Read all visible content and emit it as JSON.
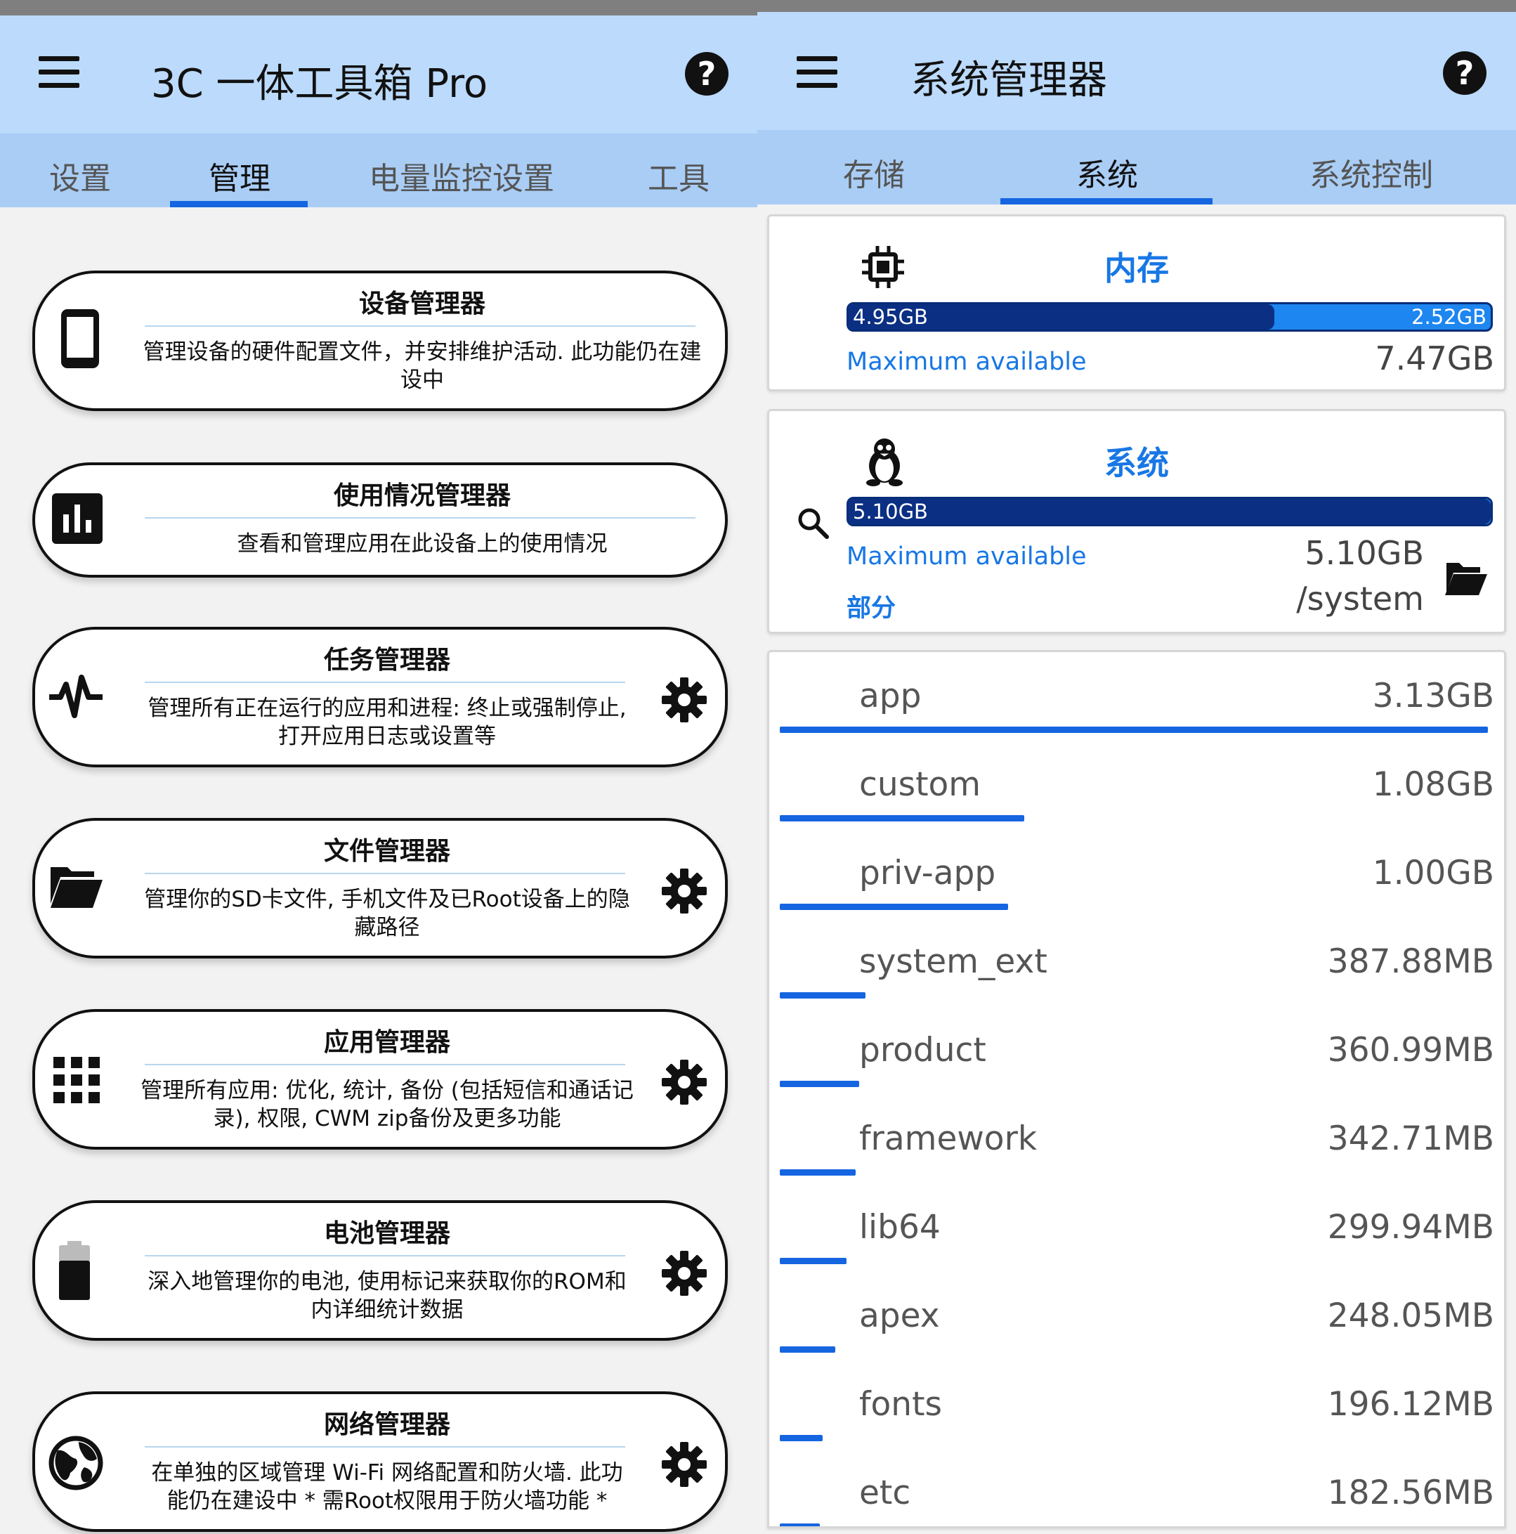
{
  "left": {
    "title": "3C 一体工具箱 Pro",
    "help": "?",
    "tabs": [
      "设置",
      "管理",
      "电量监控设置",
      "工具"
    ],
    "active_tab": 1,
    "cards": [
      {
        "title": "设备管理器",
        "desc": "管理设备的硬件配置文件，并安排维护活动. 此功能仍在建设中",
        "icon": "phone-icon",
        "gear": false
      },
      {
        "title": "使用情况管理器",
        "desc": "查看和管理应用在此设备上的使用情况",
        "icon": "bar-chart-icon",
        "gear": false
      },
      {
        "title": "任务管理器",
        "desc": "管理所有正在运行的应用和进程: 终止或强制停止, 打开应用日志或设置等",
        "icon": "pulse-icon",
        "gear": true
      },
      {
        "title": "文件管理器",
        "desc": "管理你的SD卡文件, 手机文件及已Root设备上的隐藏路径",
        "icon": "folder-icon",
        "gear": true
      },
      {
        "title": "应用管理器",
        "desc": "管理所有应用: 优化, 统计, 备份 (包括短信和通话记录), 权限, CWM zip备份及更多功能",
        "icon": "grid-icon",
        "gear": true
      },
      {
        "title": "电池管理器",
        "desc": "深入地管理你的电池, 使用标记来获取你的ROM和内详细统计数据",
        "icon": "battery-icon",
        "gear": true
      },
      {
        "title": "网络管理器",
        "desc": "在单独的区域管理 Wi-Fi 网络配置和防火墙. 此功能仍在建设中 * 需Root权限用于防火墙功能 *",
        "icon": "globe-icon",
        "gear": true
      }
    ]
  },
  "right": {
    "title": "系统管理器",
    "help": "?",
    "tabs": [
      "存储",
      "系统",
      "系统控制"
    ],
    "active_tab": 1,
    "memory": {
      "title": "内存",
      "used": "4.95GB",
      "free": "2.52GB",
      "used_fraction": 0.6627,
      "max_label": "Maximum available",
      "max_value": "7.47GB"
    },
    "system": {
      "title": "系统",
      "used": "5.10GB",
      "used_fraction": 1.0,
      "max_label": "Maximum available",
      "max_value": "5.10GB",
      "partition_label": "部分",
      "partition_value": "/system"
    },
    "items": [
      {
        "name": "app",
        "size": "3.13GB",
        "fraction": 1.0
      },
      {
        "name": "custom",
        "size": "1.08GB",
        "fraction": 0.345
      },
      {
        "name": "priv-app",
        "size": "1.00GB",
        "fraction": 0.322
      },
      {
        "name": "system_ext",
        "size": "387.88MB",
        "fraction": 0.121
      },
      {
        "name": "product",
        "size": "360.99MB",
        "fraction": 0.112
      },
      {
        "name": "framework",
        "size": "342.71MB",
        "fraction": 0.107
      },
      {
        "name": "lib64",
        "size": "299.94MB",
        "fraction": 0.094
      },
      {
        "name": "apex",
        "size": "248.05MB",
        "fraction": 0.078
      },
      {
        "name": "fonts",
        "size": "196.12MB",
        "fraction": 0.061
      },
      {
        "name": "etc",
        "size": "182.56MB",
        "fraction": 0.057
      }
    ]
  },
  "colors": {
    "accent": "#1565e0",
    "appbar": "#bbdafc",
    "tabbar": "#a9cdf5",
    "bar_dark": "#0a2f83",
    "bar_light": "#1d86f0",
    "link": "#1877e5"
  }
}
